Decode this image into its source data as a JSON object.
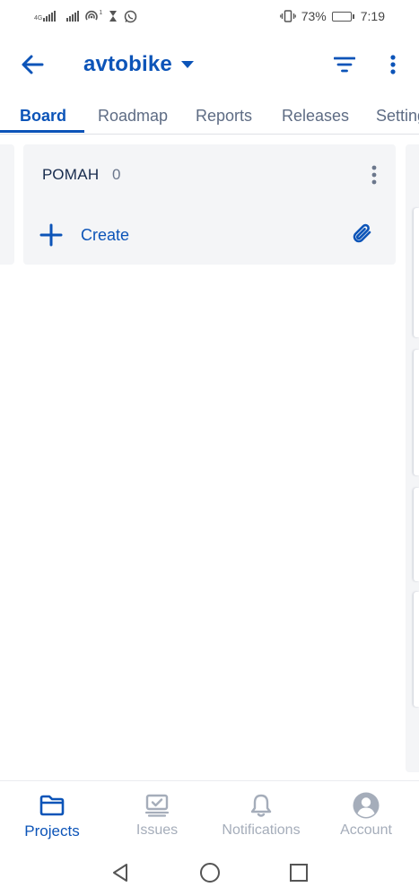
{
  "status_bar": {
    "network_label": "4G",
    "hotspot_superscript": "1",
    "battery_text": "73%",
    "battery_level": 0.73,
    "time": "7:19"
  },
  "header": {
    "project_name": "avtobike",
    "icons": {
      "back": "arrow-left-icon",
      "switcher": "caret-down-icon",
      "filter": "filter-icon",
      "more": "more-vertical-icon"
    }
  },
  "tabs": [
    {
      "label": "Board",
      "active": true
    },
    {
      "label": "Roadmap",
      "active": false
    },
    {
      "label": "Reports",
      "active": false
    },
    {
      "label": "Releases",
      "active": false
    },
    {
      "label": "Settings",
      "active": false
    }
  ],
  "board": {
    "column": {
      "title": "РОМАН",
      "count": "0",
      "create_label": "Create"
    }
  },
  "bottom_nav": [
    {
      "label": "Projects",
      "icon": "folder-icon",
      "active": true
    },
    {
      "label": "Issues",
      "icon": "issues-icon",
      "active": false
    },
    {
      "label": "Notifications",
      "icon": "bell-icon",
      "active": false
    },
    {
      "label": "Account",
      "icon": "account-icon",
      "active": false
    }
  ],
  "colors": {
    "brand": "#0c54b8",
    "inactive": "#a5adba",
    "column_bg": "#f4f5f7",
    "text": "#172b4d"
  }
}
